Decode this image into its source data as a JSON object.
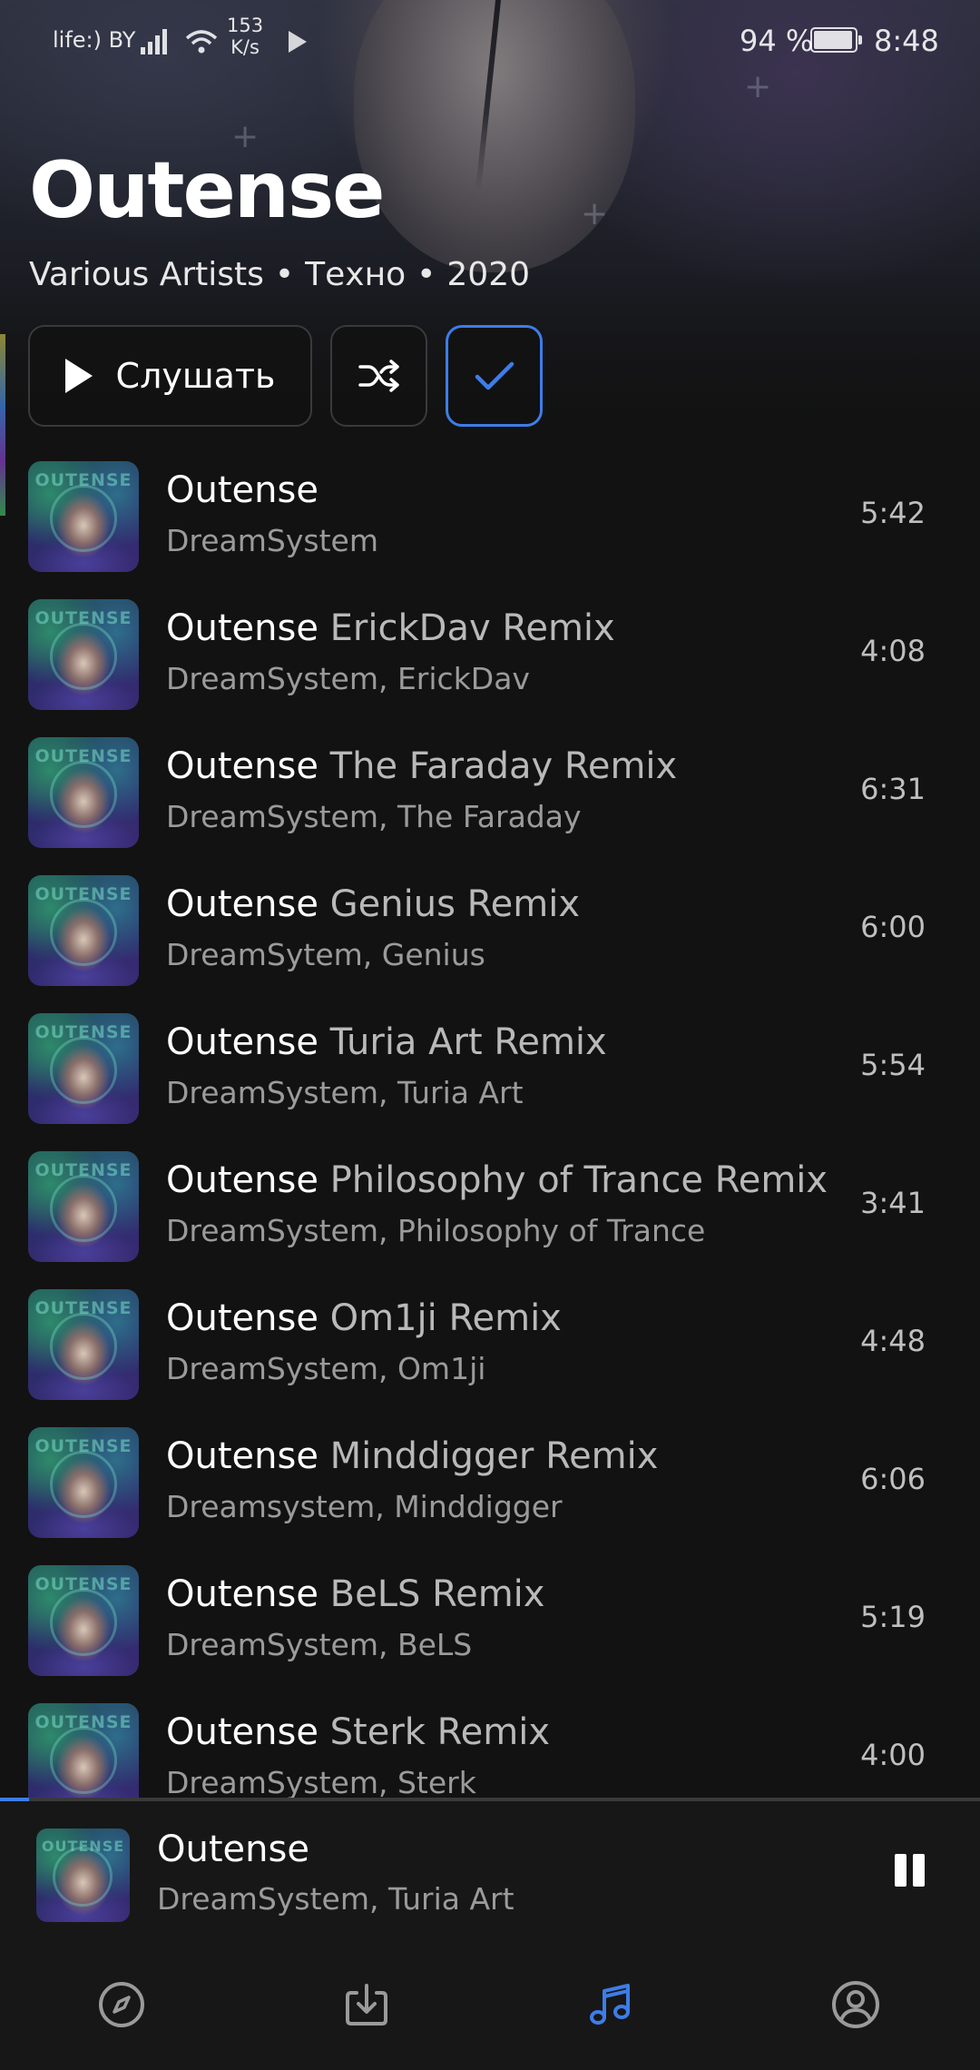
{
  "status_bar": {
    "carrier": "life:) BY",
    "speed_value": "153",
    "speed_unit": "K/s",
    "battery_percent": "94 %",
    "time": "8:48"
  },
  "album": {
    "title": "Outense",
    "artist": "Various Artists",
    "genre": "Техно",
    "year": "2020",
    "separator": "•"
  },
  "actions": {
    "listen_label": "Слушать",
    "shuffle_icon": "shuffle-icon",
    "select_icon": "checkmark-icon"
  },
  "cover_art_text": "OUTENSE",
  "tracks": [
    {
      "title": "Outense",
      "remix": "",
      "artist": "DreamSystem",
      "duration": "5:42"
    },
    {
      "title": "Outense",
      "remix": "ErickDav Remix",
      "artist": "DreamSystem, ErickDav",
      "duration": "4:08"
    },
    {
      "title": "Outense",
      "remix": "The Faraday Remix",
      "artist": "DreamSystem, The Faraday",
      "duration": "6:31"
    },
    {
      "title": "Outense",
      "remix": "Genius Remix",
      "artist": "DreamSytem, Genius",
      "duration": "6:00"
    },
    {
      "title": "Outense",
      "remix": "Turia Art Remix",
      "artist": "DreamSystem, Turia Art",
      "duration": "5:54"
    },
    {
      "title": "Outense",
      "remix": "Philosophy of Trance Remix",
      "artist": "DreamSystem, Philosophy of Trance",
      "duration": "3:41"
    },
    {
      "title": "Outense",
      "remix": "Om1ji Remix",
      "artist": "DreamSystem, Om1ji",
      "duration": "4:48"
    },
    {
      "title": "Outense",
      "remix": "Minddigger Remix",
      "artist": "Dreamsystem, Minddigger",
      "duration": "6:06"
    },
    {
      "title": "Outense",
      "remix": "BeLS Remix",
      "artist": "DreamSystem, BeLS",
      "duration": "5:19"
    },
    {
      "title": "Outense",
      "remix": "Sterk Remix",
      "artist": "DreamSystem, Sterk",
      "duration": "4:00"
    }
  ],
  "now_playing": {
    "title": "Outense",
    "artist": "DreamSystem, Turia Art",
    "progress_fraction": 0.03,
    "state_icon": "pause-icon"
  },
  "bottom_nav": [
    {
      "icon": "compass-icon",
      "active": false
    },
    {
      "icon": "download-icon",
      "active": false
    },
    {
      "icon": "music-note-icon",
      "active": true
    },
    {
      "icon": "profile-icon",
      "active": false
    }
  ],
  "colors": {
    "accent": "#3d7de8",
    "background": "#121212",
    "secondary_text": "#9b9b9b"
  }
}
